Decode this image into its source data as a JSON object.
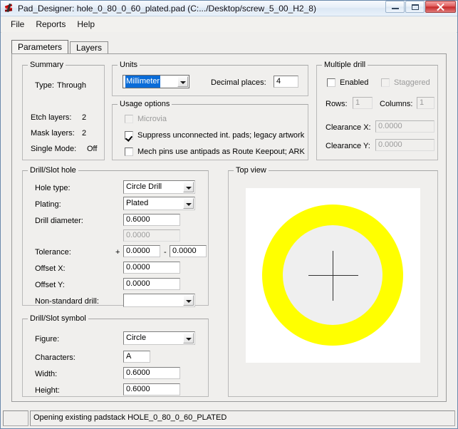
{
  "window": {
    "title": "Pad_Designer: hole_0_80_0_60_plated.pad (C:.../Desktop/screw_5_00_H2_8)",
    "icon": "app-icon",
    "buttons": {
      "minimize": "minimize-button",
      "maximize": "maximize-button",
      "close": "close-button"
    }
  },
  "menu": {
    "items": [
      {
        "label": "File"
      },
      {
        "label": "Reports"
      },
      {
        "label": "Help"
      }
    ]
  },
  "tabs": [
    {
      "label": "Parameters",
      "active": true
    },
    {
      "label": "Layers",
      "active": false
    }
  ],
  "summary": {
    "legend": "Summary",
    "type_label": "Type:",
    "type_value": "Through",
    "etch_label": "Etch layers:",
    "etch_value": "2",
    "mask_label": "Mask layers:",
    "mask_value": "2",
    "single_label": "Single Mode:",
    "single_value": "Off"
  },
  "units": {
    "legend": "Units",
    "value": "Millimeter",
    "decimal_label": "Decimal places:",
    "decimal_value": "4"
  },
  "usage": {
    "legend": "Usage options",
    "microvia": {
      "label": "Microvia",
      "checked": false,
      "enabled": false
    },
    "suppress": {
      "label": "Suppress unconnected int. pads; legacy artwork",
      "checked": true,
      "enabled": true
    },
    "mech": {
      "label": "Mech pins use antipads as Route Keepout; ARK",
      "checked": false,
      "enabled": true
    }
  },
  "multiple_drill": {
    "legend": "Multiple drill",
    "enabled": {
      "label": "Enabled",
      "checked": false
    },
    "staggered": {
      "label": "Staggered",
      "checked": false
    },
    "rows_label": "Rows:",
    "rows_value": "1",
    "columns_label": "Columns:",
    "columns_value": "1",
    "clearance_x_label": "Clearance X:",
    "clearance_x_value": "0.0000",
    "clearance_y_label": "Clearance Y:",
    "clearance_y_value": "0.0000"
  },
  "drill_hole": {
    "legend": "Drill/Slot hole",
    "hole_type_label": "Hole type:",
    "hole_type_value": "Circle Drill",
    "plating_label": "Plating:",
    "plating_value": "Plated",
    "drill_diameter_label": "Drill diameter:",
    "drill_diameter_value": "0.6000",
    "drill_diameter2_value": "0.0000",
    "tolerance_label": "Tolerance:",
    "tolerance_plus_sign": "+",
    "tolerance_plus_value": "0.0000",
    "tolerance_minus_sign": "-",
    "tolerance_minus_value": "0.0000",
    "offset_x_label": "Offset X:",
    "offset_x_value": "0.0000",
    "offset_y_label": "Offset Y:",
    "offset_y_value": "0.0000",
    "nonstandard_label": "Non-standard drill:",
    "nonstandard_value": ""
  },
  "drill_symbol": {
    "legend": "Drill/Slot symbol",
    "figure_label": "Figure:",
    "figure_value": "Circle",
    "characters_label": "Characters:",
    "characters_value": "A",
    "width_label": "Width:",
    "width_value": "0.6000",
    "height_label": "Height:",
    "height_value": "0.6000"
  },
  "top_view": {
    "legend": "Top view",
    "pad_color": "#ffff00",
    "hole_color": "#efefef",
    "background": "#ffffff"
  },
  "statusbar": {
    "left_pane": "",
    "message": "Opening existing padstack HOLE_0_80_0_60_PLATED"
  }
}
